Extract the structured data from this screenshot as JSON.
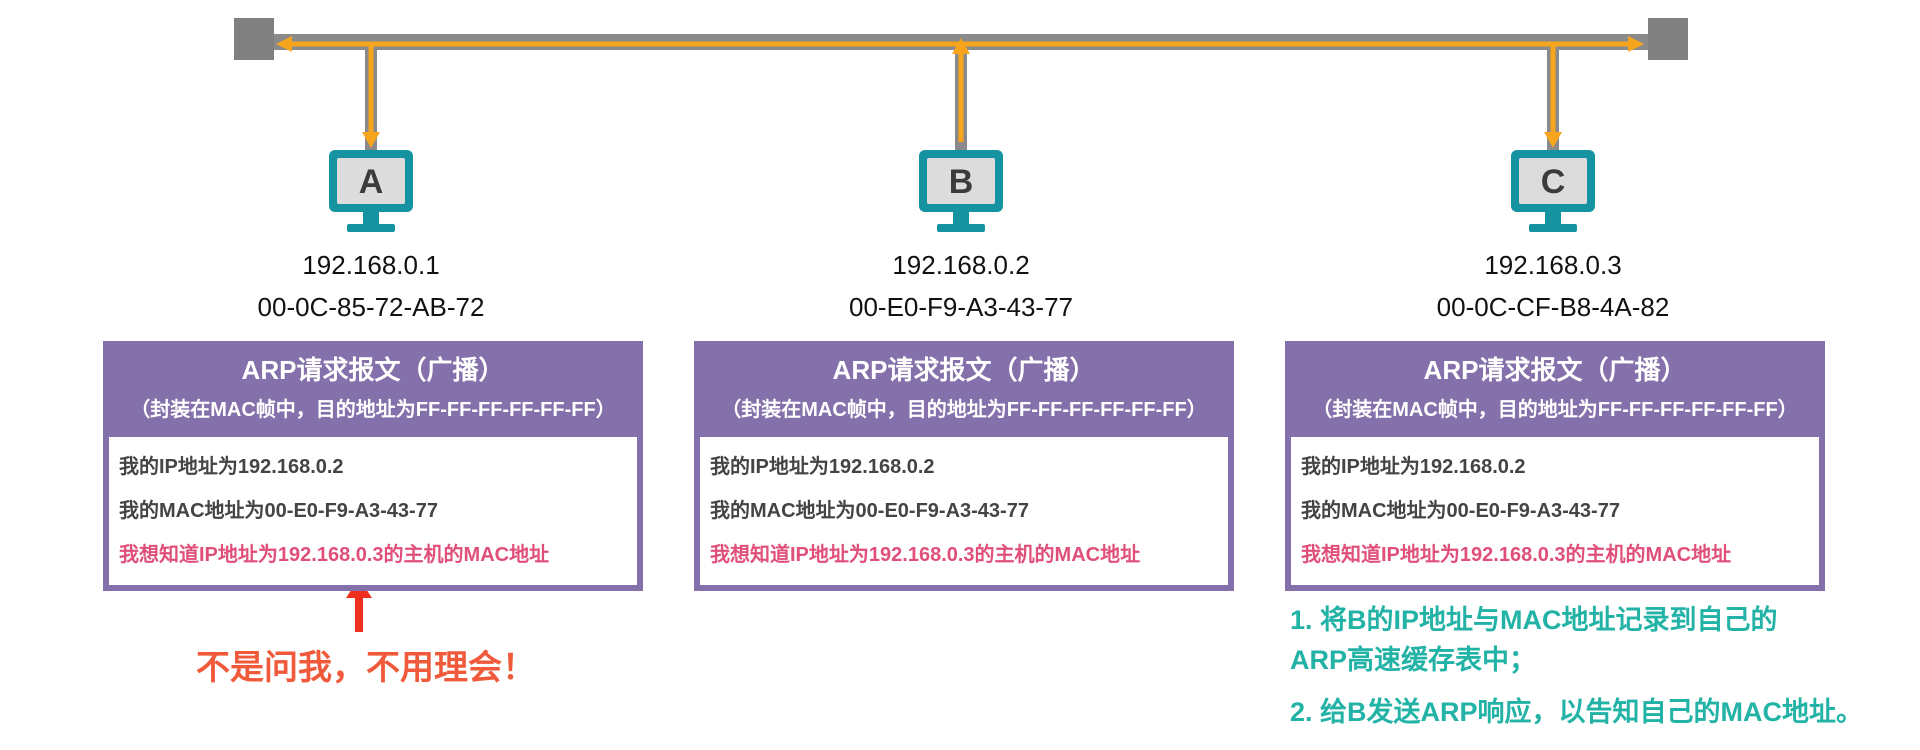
{
  "hosts": [
    {
      "label": "A",
      "ip": "192.168.0.1",
      "mac": "00-0C-85-72-AB-72"
    },
    {
      "label": "B",
      "ip": "192.168.0.2",
      "mac": "00-E0-F9-A3-43-77"
    },
    {
      "label": "C",
      "ip": "192.168.0.3",
      "mac": "00-0C-CF-B8-4A-82"
    }
  ],
  "arp_box": {
    "title": "ARP请求报文（广播）",
    "subtitle": "（封装在MAC帧中，目的地址为FF-FF-FF-FF-FF-FF）",
    "line1": "我的IP地址为192.168.0.2",
    "line2": "我的MAC地址为00-E0-F9-A3-43-77",
    "line3": "我想知道IP地址为192.168.0.3的主机的MAC地址"
  },
  "notes": {
    "host_a": "不是问我，不用理会！",
    "host_c_1a": "1. 将B的IP地址与MAC地址记录到自己的",
    "host_c_1b": "ARP高速缓存表中；",
    "host_c_2": "2. 给B发送ARP响应，以告知自己的MAC地址。"
  },
  "colors": {
    "bus_gray": "#8a8a8a",
    "signal_orange": "#f7a51d",
    "monitor_teal": "#1593a0",
    "box_purple": "#8470aa",
    "alert_red": "#f05a3a",
    "note_teal": "#23b3a6",
    "question_pink": "#e04f7a"
  }
}
